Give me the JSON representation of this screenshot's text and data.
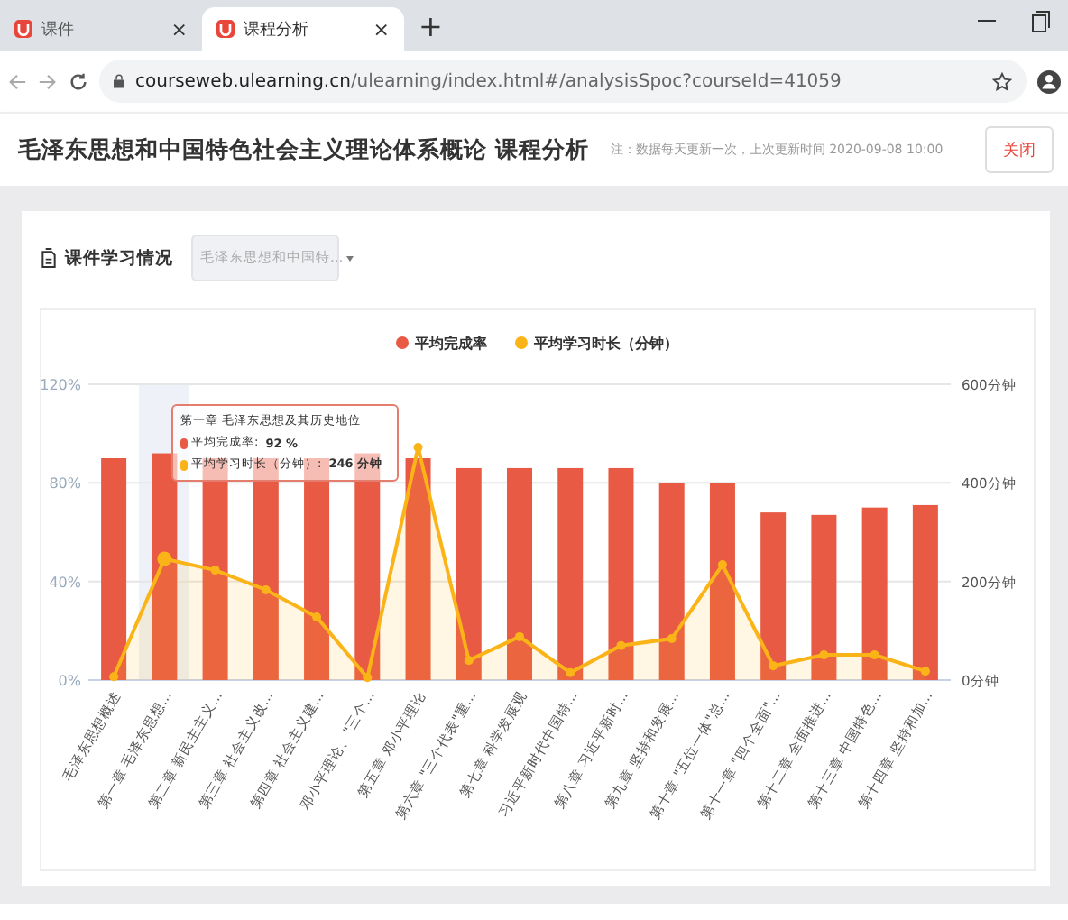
{
  "browser": {
    "tabs": [
      {
        "title": "课件",
        "selected": false,
        "close": "×"
      },
      {
        "title": "课程分析",
        "selected": true,
        "close": "×"
      }
    ],
    "new_tab": "+",
    "url_host": "courseweb.ulearning.cn",
    "url_path": "/ulearning/index.html#/analysisSpoc?courseId=41059"
  },
  "header": {
    "title": "毛泽东思想和中国特色社会主义理论体系概论 课程分析",
    "note": "注：数据每天更新一次，上次更新时间 2020-09-08 10:00",
    "close_button": "关闭"
  },
  "section": {
    "title": "课件学习情况",
    "dropdown": "毛泽东思想和中国特..."
  },
  "chart": {
    "columns": [
      {
        "hovered": false
      },
      {
        "hovered": true
      },
      {
        "hovered": false
      },
      {
        "hovered": false
      },
      {
        "hovered": false
      },
      {
        "hovered": false
      },
      {
        "hovered": false
      },
      {
        "hovered": false
      },
      {
        "hovered": false
      },
      {
        "hovered": false
      },
      {
        "hovered": false
      },
      {
        "hovered": false
      },
      {
        "hovered": false
      },
      {
        "hovered": false
      },
      {
        "hovered": false
      },
      {
        "hovered": false
      },
      {
        "hovered": false
      }
    ],
    "tooltip": {
      "title": "第一章 毛泽东思想及其历史地位",
      "rows": [
        {
          "label": "平均完成率:",
          "value": "92 %",
          "color": "#e95a44"
        },
        {
          "label": "平均学习时长（分钟）:",
          "value": "246 分钟",
          "color": "#fbb417"
        }
      ]
    },
    "completion": {
      "chart_data": {
        "type": "bar",
        "categories": [
          "毛泽东思想概述",
          "第一章 毛泽东思想...",
          "第二章 新民主主义...",
          "第三章 社会主义改...",
          "第四章 社会主义建...",
          "邓小平理论、\"三个...",
          "第五章 邓小平理论",
          "第六章 \"三个代表\"重...",
          "第七章 科学发展观",
          "习近平新时代中国特...",
          "第八章 习近平新时...",
          "第九章 坚持和发展...",
          "第十章 \"五位一体\"总...",
          "第十一章 \"四个全面\"...",
          "第十二章 全面推进...",
          "第十三章 中国特色...",
          "第十四章 坚持和加..."
        ],
        "series": [
          {
            "name": "平均完成率",
            "color": "#e95a44",
            "values": [
              90,
              92,
              90,
              90,
              90,
              92,
              90,
              86,
              86,
              86,
              86,
              80,
              80,
              68,
              67,
              70,
              71
            ]
          }
        ],
        "ylim": [
          0,
          120
        ],
        "yticks": [
          {
            "value": 0,
            "label": "0%"
          },
          {
            "value": 40,
            "label": "40%"
          },
          {
            "value": 80,
            "label": "80%"
          },
          {
            "value": 120,
            "label": "120%"
          }
        ]
      }
    },
    "duration": {
      "chart_data": {
        "type": "area",
        "series": [
          {
            "name": "平均学习时长（分钟）",
            "color": "#fbb417",
            "values": [
              7,
              246,
              223,
              183,
              128,
              5,
              472,
              40,
              88,
              15,
              70,
              84,
              234,
              29,
              51,
              51,
              18
            ]
          }
        ],
        "ylim": [
          0,
          600
        ],
        "yticks": [
          {
            "value": 0,
            "label": "0分钟"
          },
          {
            "value": 200,
            "label": "200分钟"
          },
          {
            "value": 400,
            "label": "400分钟"
          },
          {
            "value": 600,
            "label": "600分钟"
          }
        ]
      }
    }
  }
}
